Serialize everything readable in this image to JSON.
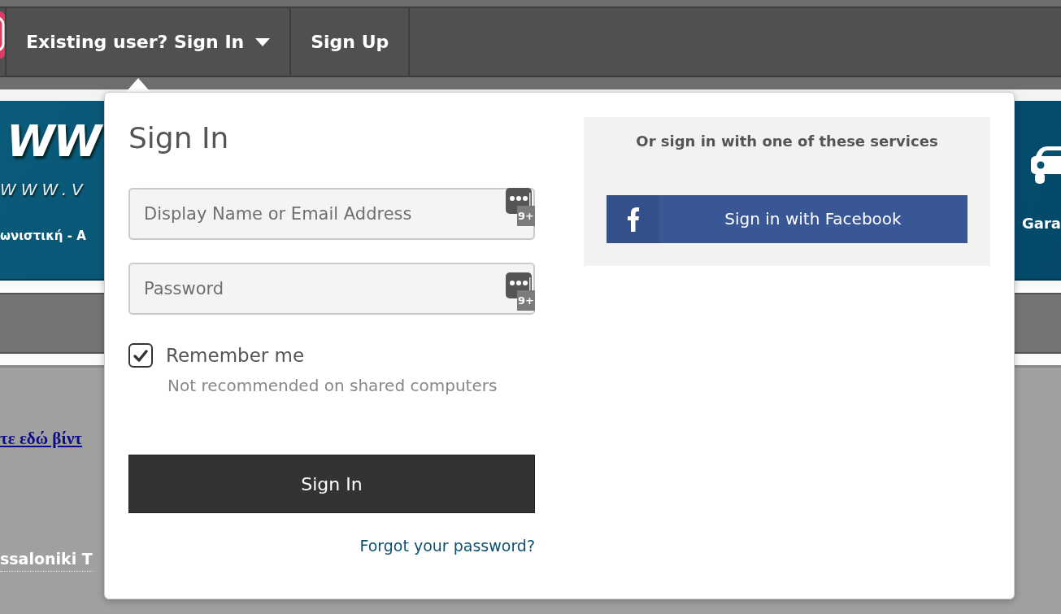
{
  "top_nav": {
    "items": [
      {
        "kind": "dropdown",
        "label": "Existing user? Sign In"
      },
      {
        "kind": "link",
        "label": "Sign Up"
      }
    ]
  },
  "banner": {
    "logo_lines": [
      "WW",
      "WWW.V",
      "ωνιστική - Α"
    ],
    "side_item": "Gara"
  },
  "content": {
    "video_link": "τε εδώ βίντ",
    "title_link": "ssaloniki T"
  },
  "sign_in_popup": {
    "title": "Sign In",
    "fields": [
      {
        "placeholder": "Display Name or Email Address",
        "badge": "9+"
      },
      {
        "placeholder": "Password",
        "badge": "9+"
      }
    ],
    "remember": {
      "label": "Remember me",
      "hint": "Not recommended on shared computers",
      "checked": true
    },
    "submit": "Sign In",
    "forgot_link": "Forgot your password?",
    "services": {
      "heading": "Or sign in with one of these services",
      "buttons": [
        {
          "kind": "facebook",
          "label": "Sign in with Facebook"
        }
      ]
    }
  }
}
